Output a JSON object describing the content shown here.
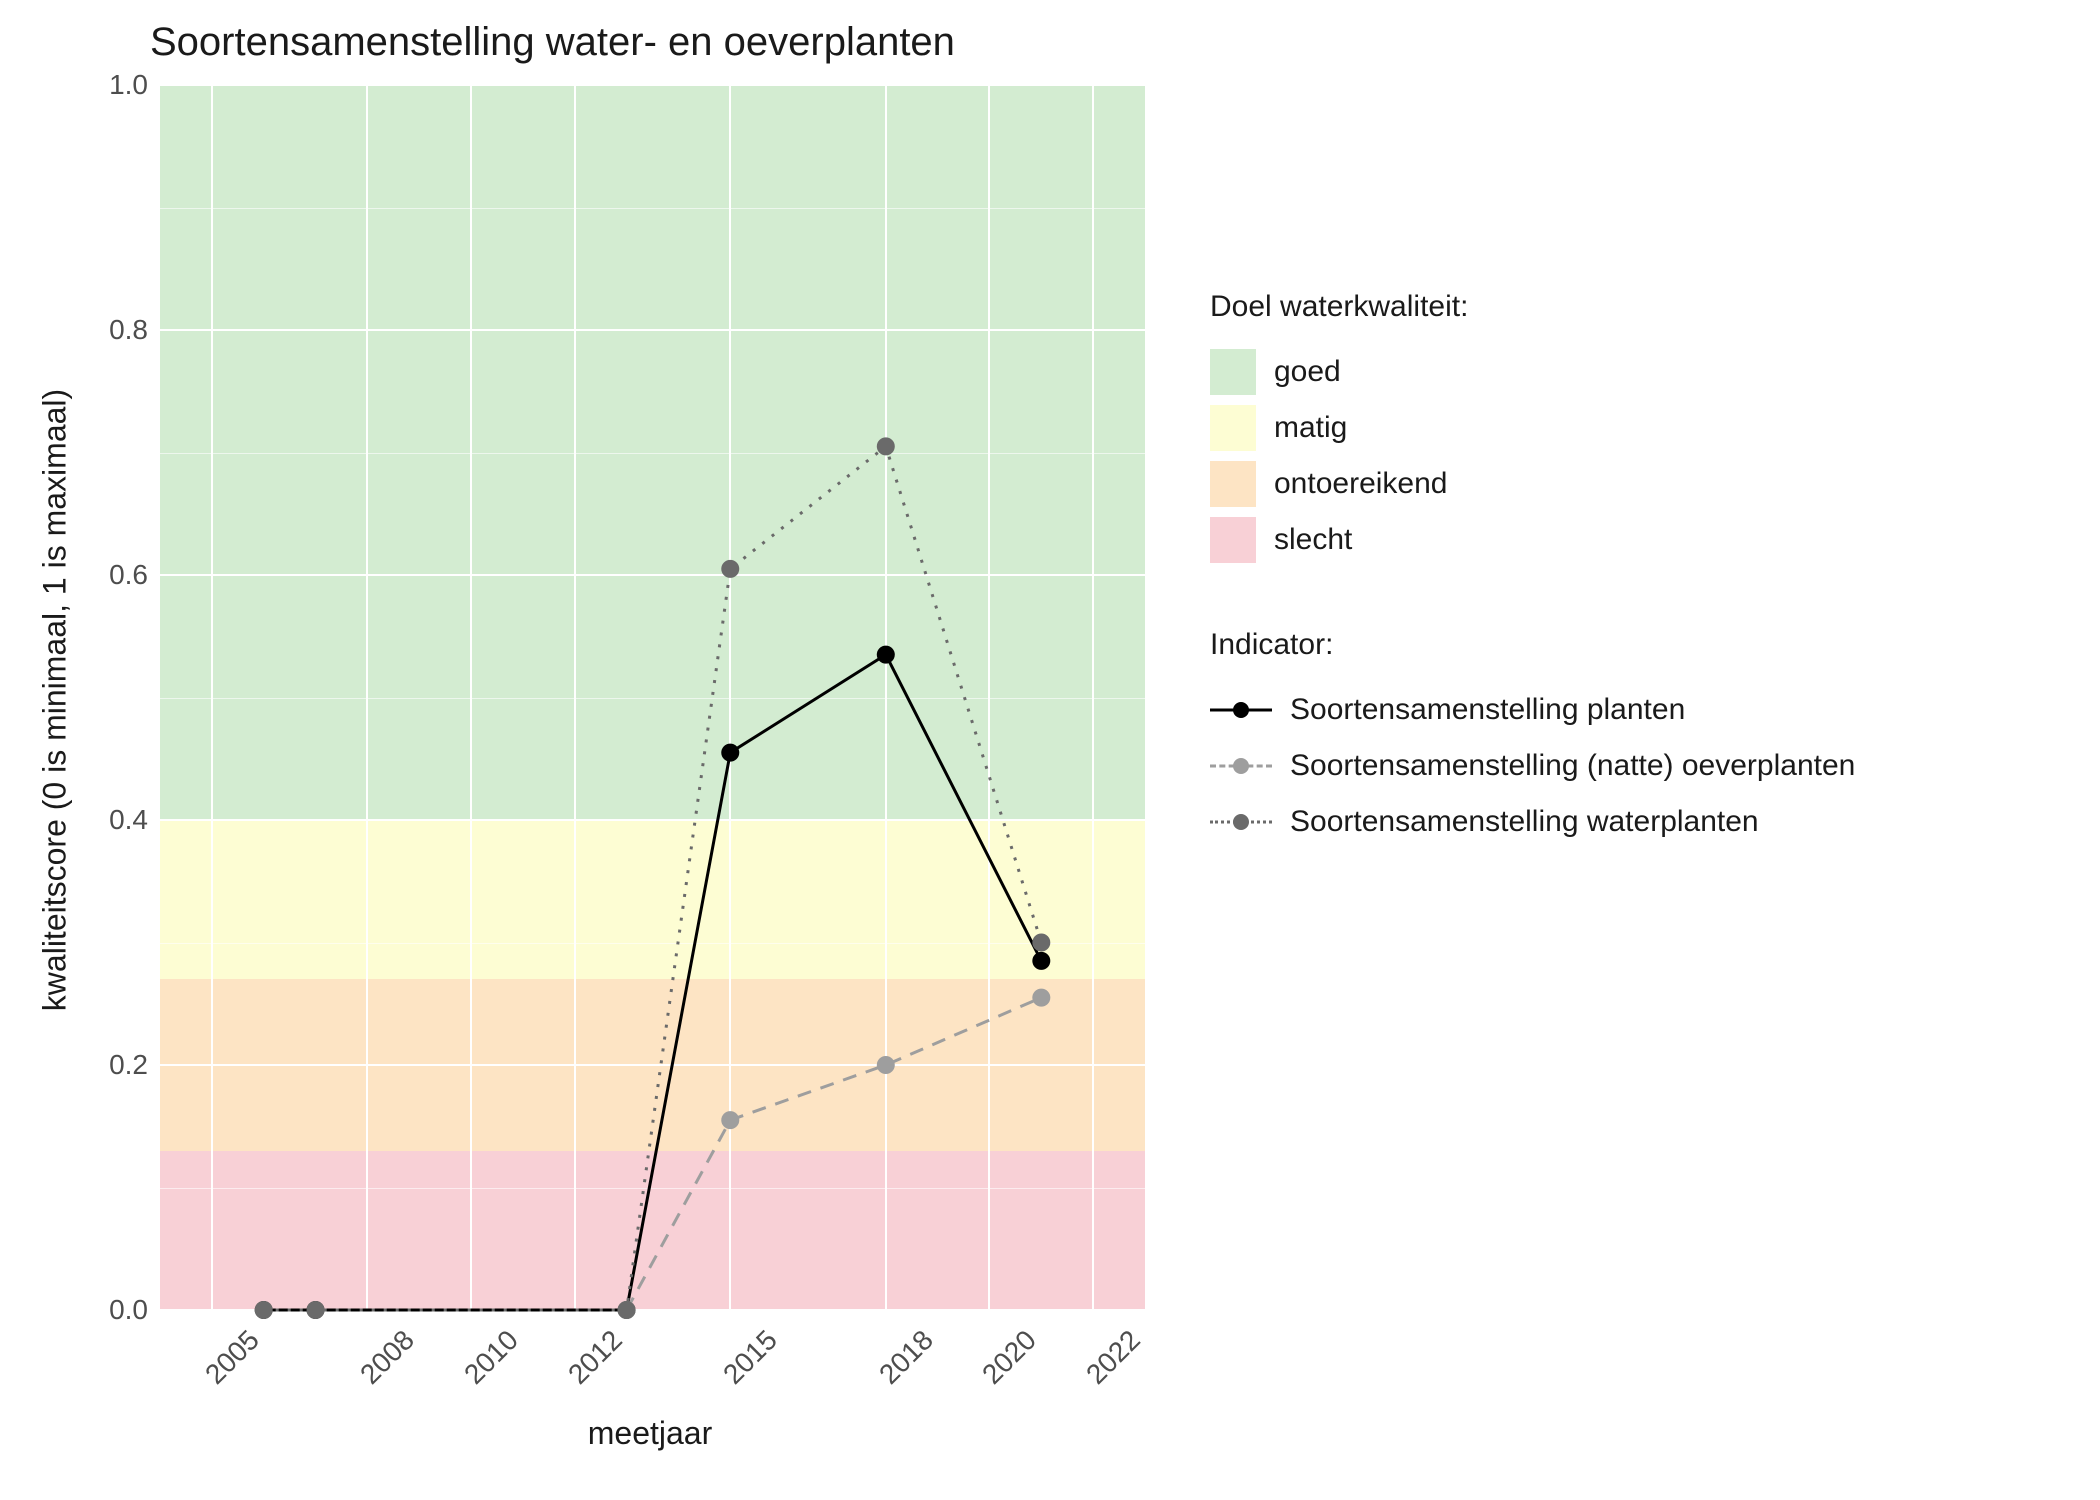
{
  "title": "Soortensamenstelling water- en oeverplanten",
  "xlabel": "meetjaar",
  "ylabel": "kwaliteitscore (0 is minimaal, 1 is maximaal)",
  "legend_bands_title": "Doel waterkwaliteit:",
  "legend_indicator_title": "Indicator:",
  "bands": {
    "goed": {
      "label": "goed",
      "color": "#d3ecd1",
      "from": 0.4,
      "to": 1.0
    },
    "matig": {
      "label": "matig",
      "color": "#fdfdd3",
      "from": 0.27,
      "to": 0.4
    },
    "ontoereikend": {
      "label": "ontoereikend",
      "color": "#fde4c4",
      "from": 0.13,
      "to": 0.27
    },
    "slecht": {
      "label": "slecht",
      "color": "#f8d0d6",
      "from": 0.0,
      "to": 0.13
    }
  },
  "indicators": {
    "planten": "Soortensamenstelling planten",
    "oeverplanten": "Soortensamenstelling (natte) oeverplanten",
    "waterplanten": "Soortensamenstelling waterplanten"
  },
  "chart_data": {
    "type": "line",
    "xlim": [
      2004,
      2023
    ],
    "ylim": [
      0.0,
      1.0
    ],
    "y_ticks": [
      0.0,
      0.2,
      0.4,
      0.6,
      0.8,
      1.0
    ],
    "x_ticks": [
      2005,
      2008,
      2010,
      2012,
      2015,
      2018,
      2020,
      2022
    ],
    "series": [
      {
        "name": "Soortensamenstelling planten",
        "style": "solid",
        "color": "#000000",
        "points": [
          {
            "x": 2006,
            "y": 0.0
          },
          {
            "x": 2007,
            "y": 0.0
          },
          {
            "x": 2013,
            "y": 0.0
          },
          {
            "x": 2015,
            "y": 0.455
          },
          {
            "x": 2018,
            "y": 0.535
          },
          {
            "x": 2021,
            "y": 0.285
          }
        ]
      },
      {
        "name": "Soortensamenstelling (natte) oeverplanten",
        "style": "dashed",
        "color": "#9e9e9e",
        "points": [
          {
            "x": 2013,
            "y": 0.0
          },
          {
            "x": 2015,
            "y": 0.155
          },
          {
            "x": 2018,
            "y": 0.2
          },
          {
            "x": 2021,
            "y": 0.255
          }
        ]
      },
      {
        "name": "Soortensamenstelling waterplanten",
        "style": "dotted",
        "color": "#6a6a6a",
        "points": [
          {
            "x": 2006,
            "y": 0.0
          },
          {
            "x": 2007,
            "y": 0.0
          },
          {
            "x": 2013,
            "y": 0.0
          },
          {
            "x": 2015,
            "y": 0.605
          },
          {
            "x": 2018,
            "y": 0.705
          },
          {
            "x": 2021,
            "y": 0.3
          }
        ]
      }
    ]
  }
}
